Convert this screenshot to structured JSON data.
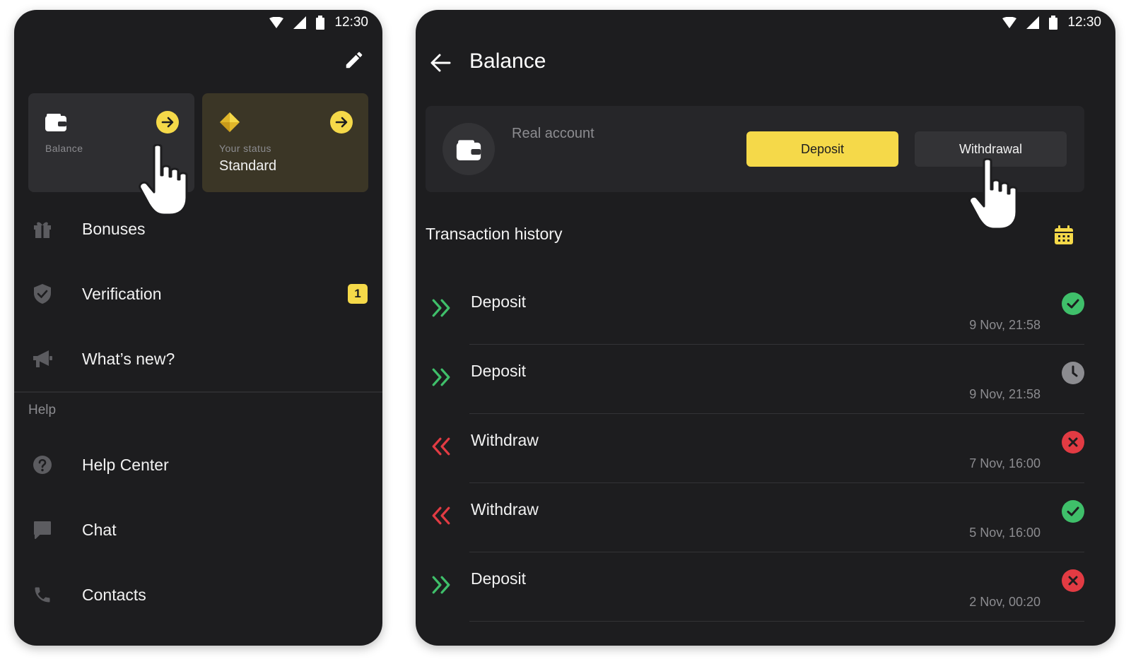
{
  "status_bar": {
    "time": "12:30"
  },
  "colors": {
    "accent": "#f5d949",
    "background": "#1d1d1f",
    "incoming": "#3fbf6a",
    "outgoing": "#e23b43",
    "success": "#3fbf6a",
    "error": "#e23b43",
    "pending": "#8c8c90"
  },
  "menu_screen": {
    "balance_card": {
      "label": "Balance",
      "icon": "wallet-icon"
    },
    "status_card": {
      "label": "Your status",
      "value": "Standard",
      "icon": "diamond-icon"
    },
    "items": [
      {
        "label": "Bonuses",
        "icon": "gift-icon"
      },
      {
        "label": "Verification",
        "icon": "shield-icon",
        "badge": "1"
      },
      {
        "label": "What’s new?",
        "icon": "megaphone-icon"
      }
    ],
    "help_section": {
      "title": "Help",
      "items": [
        {
          "label": "Help Center",
          "icon": "question-icon"
        },
        {
          "label": "Chat",
          "icon": "chat-icon"
        },
        {
          "label": "Contacts",
          "icon": "phone-icon"
        }
      ]
    }
  },
  "balance_screen": {
    "title": "Balance",
    "account": {
      "label": "Real account",
      "deposit_label": "Deposit",
      "withdrawal_label": "Withdrawal"
    },
    "history_title": "Transaction history",
    "transactions": [
      {
        "type": "Deposit",
        "date": "9 Nov, 21:58",
        "direction": "in",
        "status": "success"
      },
      {
        "type": "Deposit",
        "date": "9 Nov, 21:58",
        "direction": "in",
        "status": "pending"
      },
      {
        "type": "Withdraw",
        "date": "7 Nov, 16:00",
        "direction": "out",
        "status": "error"
      },
      {
        "type": "Withdraw",
        "date": "5 Nov, 16:00",
        "direction": "out",
        "status": "success"
      },
      {
        "type": "Deposit",
        "date": "2 Nov, 00:20",
        "direction": "in",
        "status": "error"
      }
    ]
  }
}
